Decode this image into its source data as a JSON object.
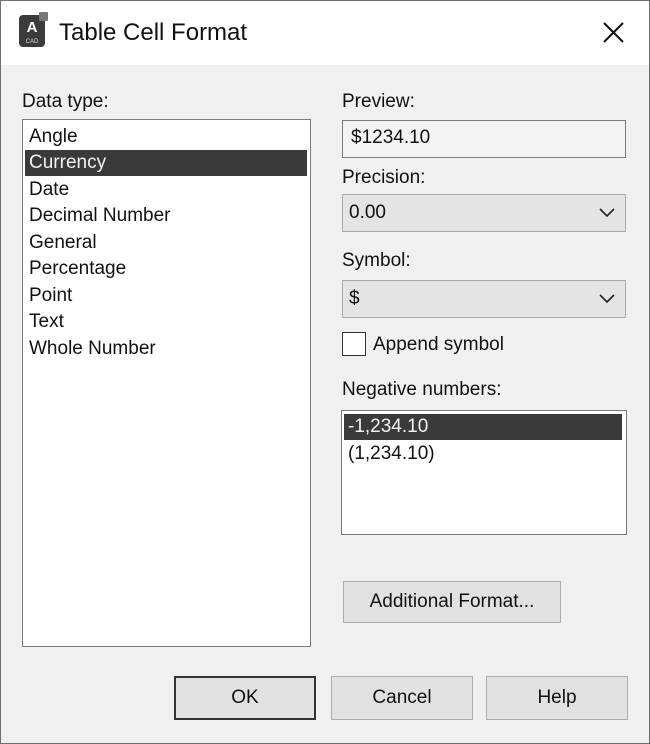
{
  "window": {
    "title": "Table Cell Format",
    "icon": "autocad-app-icon",
    "close_icon": "close-icon"
  },
  "data_type": {
    "label": "Data type:",
    "items": [
      "Angle",
      "Currency",
      "Date",
      "Decimal Number",
      "General",
      "Percentage",
      "Point",
      "Text",
      "Whole Number"
    ],
    "selected": "Currency"
  },
  "preview": {
    "label": "Preview:",
    "value": "$1234.10"
  },
  "precision": {
    "label": "Precision:",
    "value": "0.00"
  },
  "symbol": {
    "label": "Symbol:",
    "value": "$"
  },
  "append_symbol": {
    "label": "Append symbol",
    "checked": false
  },
  "negative_numbers": {
    "label": "Negative numbers:",
    "items": [
      "-1,234.10",
      "(1,234.10)"
    ],
    "selected": "-1,234.10"
  },
  "buttons": {
    "additional_format": "Additional Format...",
    "ok": "OK",
    "cancel": "Cancel",
    "help": "Help"
  },
  "colors": {
    "selection": "#3a3a3a",
    "dialog_bg": "#f0f0f0"
  }
}
